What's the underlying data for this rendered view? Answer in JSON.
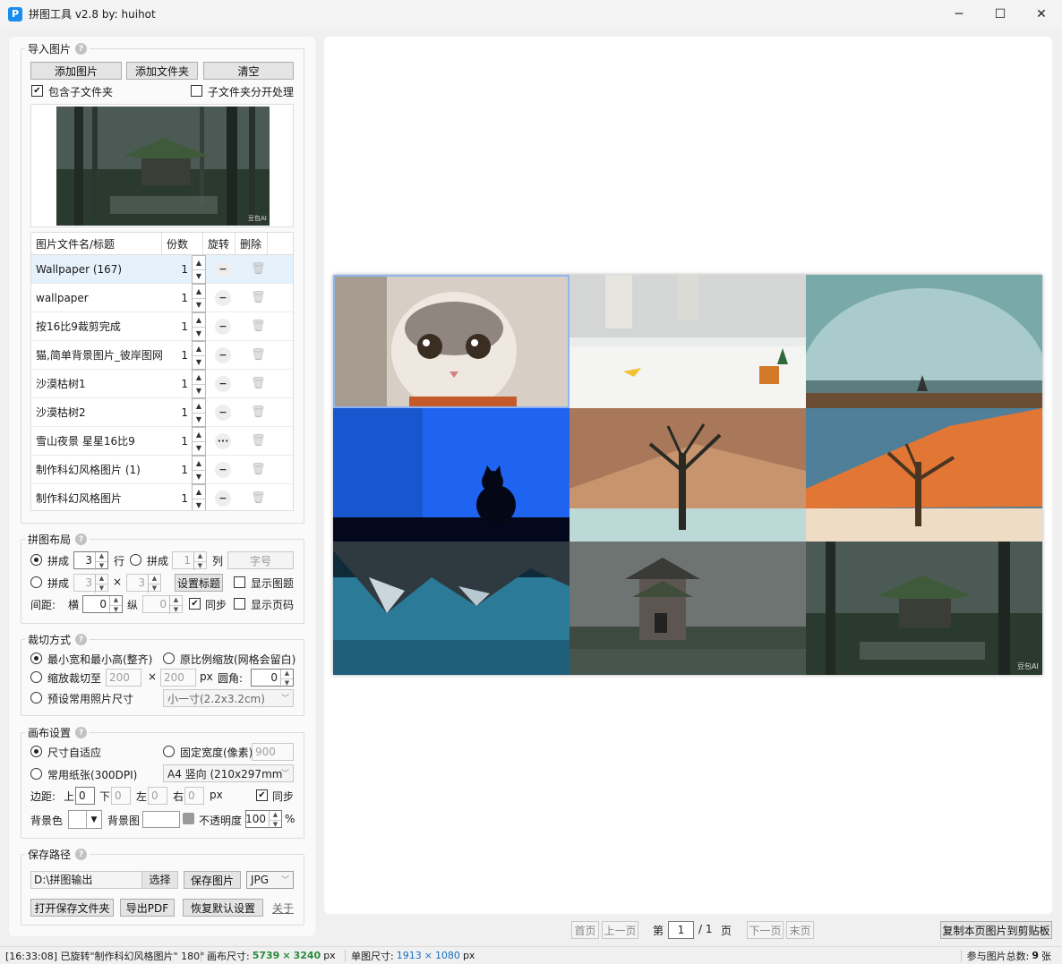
{
  "window": {
    "icon_letter": "P",
    "title": "拼图工具 v2.8 by: huihot",
    "minimize": "─",
    "maximize": "☐",
    "close": "✕"
  },
  "import": {
    "title": "导入图片",
    "help": "?",
    "add_image": "添加图片",
    "add_folder": "添加文件夹",
    "clear": "清空",
    "include_subfolders": "包含子文件夹",
    "include_subfolders_checked": true,
    "separate_subfolders": "子文件夹分开处理",
    "separate_subfolders_checked": false,
    "preview_watermark": "豆包AI",
    "columns": [
      "图片文件名/标题",
      "份数",
      "旋转",
      "删除"
    ],
    "rows": [
      {
        "name": "Wallpaper (167)",
        "count": "1",
        "rotate": "−"
      },
      {
        "name": "wallpaper",
        "count": "1",
        "rotate": "−"
      },
      {
        "name": "按16比9裁剪完成",
        "count": "1",
        "rotate": "−"
      },
      {
        "name": "猫,简单背景图片_彼岸图网",
        "count": "1",
        "rotate": "−"
      },
      {
        "name": "沙漠枯树1",
        "count": "1",
        "rotate": "−"
      },
      {
        "name": "沙漠枯树2",
        "count": "1",
        "rotate": "−"
      },
      {
        "name": "雪山夜景 星星16比9",
        "count": "1",
        "rotate": "···"
      },
      {
        "name": "制作科幻风格图片 (1)",
        "count": "1",
        "rotate": "−"
      },
      {
        "name": "制作科幻风格图片",
        "count": "1",
        "rotate": "−"
      }
    ]
  },
  "layout": {
    "title": "拼图布局",
    "help": "?",
    "opt1": "拼成",
    "rows_value": "3",
    "rows_unit": "行",
    "opt1b": "拼成",
    "cols_value": "1",
    "cols_unit": "列",
    "font_btn": "字号",
    "opt2": "拼成",
    "grid_a": "3",
    "times": "×",
    "grid_b": "3",
    "set_title_btn": "设置标题",
    "show_title": "显示图题",
    "spacing_label": "间距:",
    "h_label": "横",
    "h_value": "0",
    "v_label": "纵",
    "v_value": "0",
    "sync": "同步",
    "show_page": "显示页码"
  },
  "crop": {
    "title": "裁切方式",
    "help": "?",
    "opt_min": "最小宽和最小高(整齐)",
    "opt_ratio": "原比例缩放(网格会留白)",
    "opt_scale": "缩放裁切至",
    "w": "200",
    "x": "×",
    "h": "200",
    "px": "px",
    "radius_label": "圆角:",
    "radius": "0",
    "opt_preset": "预设常用照片尺寸",
    "preset_value": "小一寸(2.2x3.2cm)"
  },
  "canvas": {
    "title": "画布设置",
    "help": "?",
    "opt_auto": "尺寸自适应",
    "opt_fixed": "固定宽度(像素)",
    "fixed_value": "900",
    "opt_paper": "常用纸张(300DPI)",
    "paper_value": "A4 竖向 (210x297mm",
    "margin_label": "边距:",
    "top_label": "上",
    "top": "0",
    "bottom_label": "下",
    "bottom": "0",
    "left_label": "左",
    "left": "0",
    "right_label": "右",
    "right": "0",
    "px": "px",
    "sync": "同步",
    "bg_color_label": "背景色",
    "bg_image_label": "背景图",
    "opacity_label": "不透明度",
    "opacity": "100",
    "percent": "%"
  },
  "save": {
    "title": "保存路径",
    "help": "?",
    "path": "D:\\拼图输出",
    "choose": "选择",
    "save_image": "保存图片",
    "format": "JPG",
    "open_folder": "打开保存文件夹",
    "export_pdf": "导出PDF",
    "restore": "恢复默认设置",
    "about": "关于"
  },
  "pager": {
    "first": "首页",
    "prev": "上一页",
    "page_prefix": "第",
    "page": "1",
    "slash_total": "/ 1",
    "page_suffix": "页",
    "next": "下一页",
    "last": "末页",
    "copy": "复制本页图片到剪贴板"
  },
  "status": {
    "message": "[16:33:08] 已旋转\"制作科幻风格图片\" 180°",
    "canvas_label": "画布尺寸:",
    "canvas_w": "5739",
    "canvas_x": "×",
    "canvas_h": "3240",
    "canvas_unit": "px",
    "single_label": "单图尺寸:",
    "single_w": "1913",
    "single_x": "×",
    "single_h": "1080",
    "single_unit": "px",
    "total_label": "参与图片总数:",
    "total": "9",
    "total_unit": "张"
  },
  "grid_watermarks": [
    "豆包AI",
    "豆包AI"
  ]
}
